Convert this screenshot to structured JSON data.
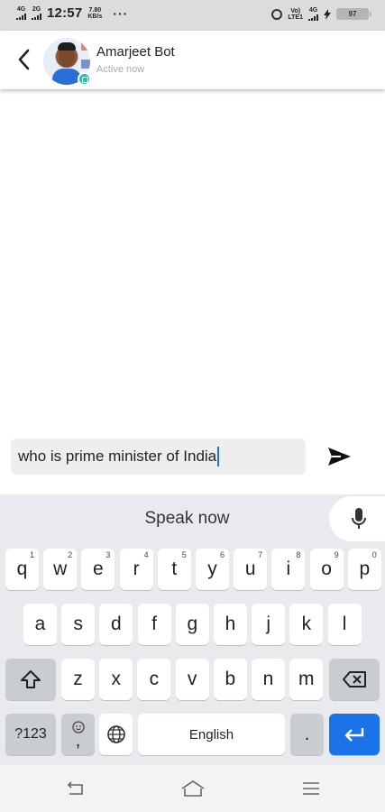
{
  "status_bar": {
    "sim1": "4G",
    "sim2": "2G",
    "time": "12:57",
    "speed_value": "7.80",
    "speed_unit": "KB/s",
    "more": "···",
    "volte_top": "Vo)",
    "volte_bottom": "LTE1",
    "net": "4G",
    "battery": "97"
  },
  "header": {
    "title": "Amarjeet Bot",
    "status": "Active now"
  },
  "composer": {
    "text": "who is prime minister of India"
  },
  "keyboard": {
    "speak_now": "Speak now",
    "row1": [
      {
        "k": "q",
        "n": "1"
      },
      {
        "k": "w",
        "n": "2"
      },
      {
        "k": "e",
        "n": "3"
      },
      {
        "k": "r",
        "n": "4"
      },
      {
        "k": "t",
        "n": "5"
      },
      {
        "k": "y",
        "n": "6"
      },
      {
        "k": "u",
        "n": "7"
      },
      {
        "k": "i",
        "n": "8"
      },
      {
        "k": "o",
        "n": "9"
      },
      {
        "k": "p",
        "n": "0"
      }
    ],
    "row2": [
      "a",
      "s",
      "d",
      "f",
      "g",
      "h",
      "j",
      "k",
      "l"
    ],
    "row3": [
      "z",
      "x",
      "c",
      "v",
      "b",
      "n",
      "m"
    ],
    "symbols_label": "?123",
    "comma": ",",
    "space_label": "English",
    "period": "."
  },
  "icons": {
    "back": "chevron-left-icon",
    "send": "send-icon",
    "mic": "microphone-icon",
    "shift": "shift-icon",
    "backspace": "backspace-icon",
    "globe": "globe-icon",
    "emoji": "emoji-icon",
    "enter": "enter-icon",
    "nav_back": "nav-back-icon",
    "nav_home": "nav-home-icon",
    "nav_menu": "nav-menu-icon"
  },
  "colors": {
    "accent": "#1a73e8",
    "bot_badge": "#3fb8a3",
    "status_gray": "#aaaaaa"
  }
}
